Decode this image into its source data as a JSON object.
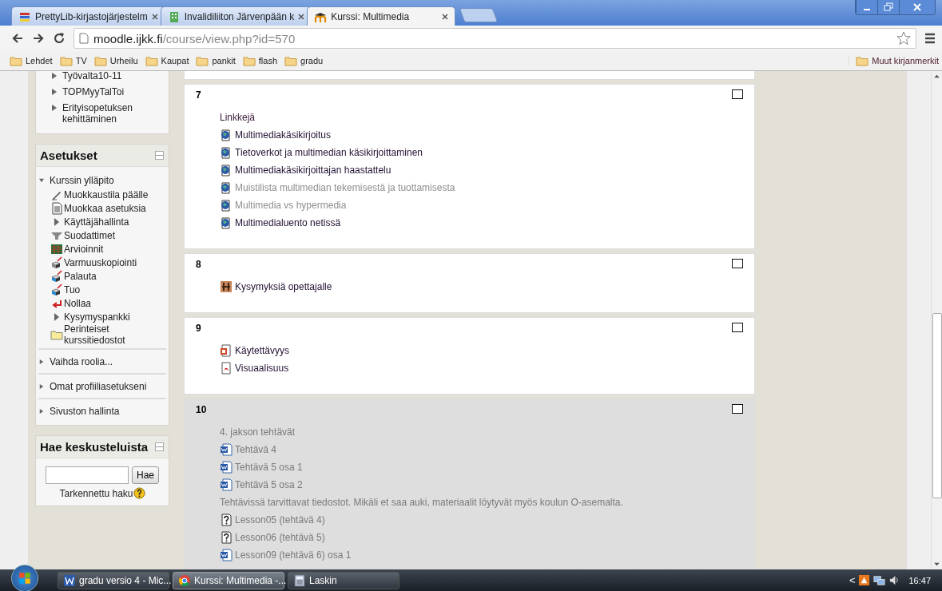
{
  "browser": {
    "tabs": [
      {
        "title": "PrettyLib-kirjastojärjestelm",
        "selected": false,
        "kind": "books"
      },
      {
        "title": "Invalidiliiton Järvenpään k",
        "selected": false,
        "kind": "building"
      },
      {
        "title": "Kurssi: Multimedia",
        "selected": true,
        "kind": "moodle"
      }
    ],
    "address": {
      "host": "moodle.ijkk.fi",
      "path": "/course/view.php?id=570"
    },
    "bookmarks": [
      "Lehdet",
      "TV",
      "Urheilu",
      "Kaupat",
      "pankit",
      "flash",
      "gradu"
    ],
    "other_bookmarks": "Muut kirjanmerkit"
  },
  "navigation": {
    "items": [
      "Työvalta10-11",
      "TOPMyyTalToi",
      "Erityisopetuksen kehittäminen"
    ]
  },
  "settings": {
    "title": "Asetukset",
    "items": [
      {
        "label": "Kurssin ylläpito",
        "expanded": true,
        "children": [
          {
            "label": "Muokkaustila päälle",
            "kind": "pencil"
          },
          {
            "label": "Muokkaa asetuksia",
            "kind": "doc"
          },
          {
            "label": "Käyttäjähallinta",
            "kind": "branch"
          },
          {
            "label": "Suodattimet",
            "kind": "filter"
          },
          {
            "label": "Arvioinnit",
            "kind": "grades"
          },
          {
            "label": "Varmuuskopiointi",
            "kind": "backup"
          },
          {
            "label": "Palauta",
            "kind": "restore"
          },
          {
            "label": "Tuo",
            "kind": "restore"
          },
          {
            "label": "Nollaa",
            "kind": "reset"
          },
          {
            "label": "Kysymyspankki",
            "kind": "branch"
          },
          {
            "label": "Perinteiset kurssitiedostot",
            "kind": "folder"
          }
        ]
      },
      {
        "label": "Vaihda roolia...",
        "expanded": false
      },
      {
        "label": "Omat profiiliasetukseni",
        "expanded": false
      },
      {
        "label": "Sivuston hallinta",
        "expanded": false
      }
    ]
  },
  "forum_search": {
    "title": "Hae keskusteluista",
    "button": "Hae",
    "advanced": "Tarkennettu haku"
  },
  "sections": [
    {
      "number": "7",
      "hidden": false,
      "items": [
        {
          "kind": "label",
          "text": "Linkkejä",
          "dimmed": false
        },
        {
          "kind": "url",
          "text": "Multimediakäsikirjoitus",
          "dimmed": false
        },
        {
          "kind": "url",
          "text": "Tietoverkot ja multimedian käsikirjoittaminen",
          "dimmed": false
        },
        {
          "kind": "url",
          "text": "Multimediakäsikirjoittajan haastattelu",
          "dimmed": false
        },
        {
          "kind": "url",
          "text": "Muistilista multimedian tekemisestä ja tuottamisesta",
          "dimmed": true
        },
        {
          "kind": "url",
          "text": "Multimedia vs hypermedia",
          "dimmed": true
        },
        {
          "kind": "url",
          "text": "Multimedialuento netissä",
          "dimmed": false
        }
      ]
    },
    {
      "number": "8",
      "hidden": false,
      "items": [
        {
          "kind": "chat",
          "text": "Kysymyksiä opettajalle",
          "dimmed": false
        }
      ]
    },
    {
      "number": "9",
      "hidden": false,
      "items": [
        {
          "kind": "ppt",
          "text": "Käytettävyys",
          "dimmed": false
        },
        {
          "kind": "pdf",
          "text": "Visuaalisuus",
          "dimmed": false
        }
      ]
    },
    {
      "number": "10",
      "hidden": true,
      "items": [
        {
          "kind": "label",
          "text": "4. jakson tehtävät",
          "dimmed": true
        },
        {
          "kind": "word",
          "text": "Tehtävä 4",
          "dimmed": true
        },
        {
          "kind": "word",
          "text": "Tehtävä 5 osa 1",
          "dimmed": true
        },
        {
          "kind": "word",
          "text": "Tehtävä 5 osa 2",
          "dimmed": true
        },
        {
          "kind": "label",
          "text": "Tehtävissä tarvittavat tiedostot. Mikäli et saa auki, materiaalit löytyvät myös koulun O-asemalta.",
          "dimmed": true
        },
        {
          "kind": "lesson",
          "text": "Lesson05 (tehtävä 4)",
          "dimmed": true
        },
        {
          "kind": "lesson",
          "text": "Lesson06 (tehtävä 5)",
          "dimmed": true
        },
        {
          "kind": "word",
          "text": "Lesson09 (tehtävä 6) osa 1",
          "dimmed": true
        }
      ]
    }
  ],
  "taskbar": {
    "items": [
      {
        "title": "gradu versio 4 - Mic...",
        "kind": "word",
        "selected": false
      },
      {
        "title": "Kurssi: Multimedia -...",
        "kind": "chrome",
        "selected": true
      },
      {
        "title": "Laskin",
        "kind": "calc",
        "selected": false
      }
    ],
    "tray_arrow": "<",
    "time": "16:47"
  }
}
